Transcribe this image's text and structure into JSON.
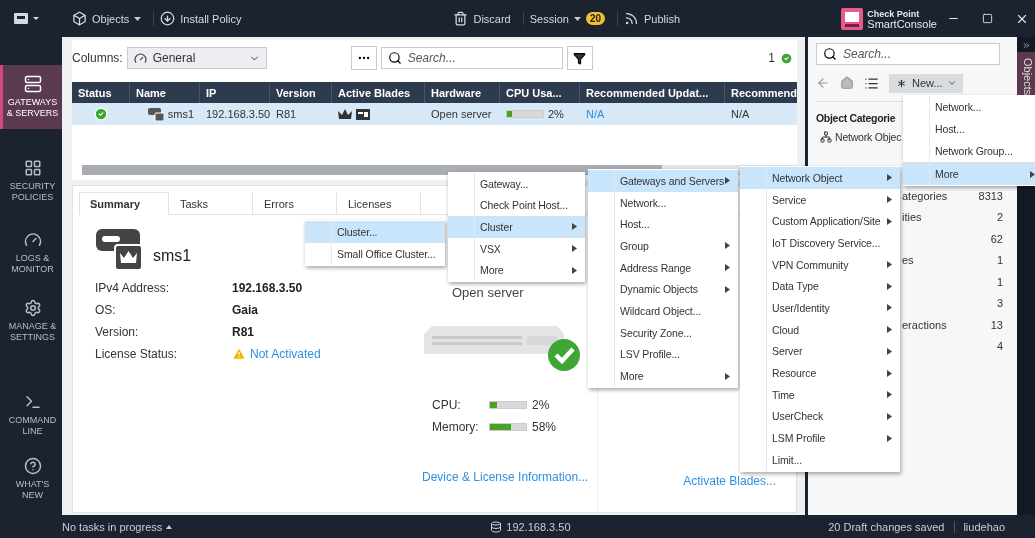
{
  "toolbar": {
    "left": [
      {
        "kind": "menu",
        "label": "Objects"
      },
      {
        "kind": "button",
        "label": "Install Policy"
      }
    ],
    "center": [
      {
        "kind": "button",
        "label": "Discard"
      },
      {
        "kind": "menu",
        "label": "Session",
        "badge": "20"
      },
      {
        "kind": "button",
        "label": "Publish"
      }
    ],
    "logo": {
      "brand": "Check Point",
      "product": "SmartConsole"
    }
  },
  "nav": [
    {
      "label": "GATEWAYS\n& SERVERS",
      "selected": true
    },
    {
      "label": "SECURITY\nPOLICIES",
      "selected": false
    },
    {
      "label": "LOGS &\nMONITOR",
      "selected": false
    },
    {
      "label": "MANAGE &\nSETTINGS",
      "selected": false
    },
    {
      "label": "COMMAND\nLINE",
      "selected": false
    },
    {
      "label": "WHAT'S\nNEW",
      "selected": false
    }
  ],
  "columns_bar": {
    "label": "Columns:",
    "value": "General",
    "search_placeholder": "Search...",
    "count": "1"
  },
  "table": {
    "columns": [
      "Status",
      "Name",
      "IP",
      "Version",
      "Active Blades",
      "Hardware",
      "CPU Usa...",
      "Recommended Updat...",
      "Recommend"
    ],
    "rows": [
      {
        "selected": true,
        "healthy": true,
        "name": "sms1",
        "ip": "192.168.3.50",
        "version": "R81",
        "hardware": "Open server",
        "cpu": {
          "level": 0.15,
          "reading": "2%"
        },
        "recommended_updates": "N/A",
        "recommend": "N/A"
      }
    ]
  },
  "details": {
    "tabs": [
      {
        "label": "Summary",
        "selected": true
      },
      {
        "label": "Tasks",
        "selected": false
      },
      {
        "label": "Errors",
        "selected": false
      },
      {
        "label": "Licenses",
        "selected": false
      }
    ],
    "name": "sms1",
    "fields": [
      {
        "label": "IPv4 Address:",
        "value": "192.168.3.50",
        "kind": "text"
      },
      {
        "label": "OS:",
        "value": "Gaia",
        "kind": "text"
      },
      {
        "label": "Version:",
        "value": "R81",
        "kind": "text"
      },
      {
        "label": "License Status:",
        "value": "Not Activated",
        "kind": "warning"
      }
    ],
    "hardware": "Open server",
    "metrics": [
      {
        "label": "CPU:",
        "level": 0.2,
        "reading": "2%"
      },
      {
        "label": "Memory:",
        "level": 0.58,
        "reading": "58%"
      }
    ],
    "links": [
      "Device & License Information...",
      "Activate Blades..."
    ]
  },
  "right_panel": {
    "search_placeholder": "Search...",
    "new_label": "New...",
    "heading": "Object Categorie",
    "first_item": "Network Objec",
    "rows": [
      {
        "label": "ategories",
        "count": "8313"
      },
      {
        "label": "ities",
        "count": "2"
      },
      {
        "count": "62"
      },
      {
        "label": "es",
        "count": "1"
      },
      {
        "count": "1"
      },
      {
        "count": "3"
      },
      {
        "label": "eractions",
        "count": "13"
      },
      {
        "count": "4"
      }
    ],
    "side_tab": "Objects"
  },
  "menus": [
    {
      "items": [
        {
          "label": "Cluster...",
          "submenu": false,
          "selected": true
        },
        {
          "label": "Small Office Cluster...",
          "submenu": false,
          "selected": false
        }
      ]
    },
    {
      "items": [
        {
          "label": "Gateway...",
          "submenu": false,
          "selected": false
        },
        {
          "label": "Check Point Host...",
          "submenu": false,
          "selected": false
        },
        {
          "label": "Cluster",
          "submenu": true,
          "selected": true
        },
        {
          "label": "VSX",
          "submenu": true,
          "selected": false
        },
        {
          "label": "More",
          "submenu": true,
          "selected": false
        }
      ]
    },
    {
      "items": [
        {
          "label": "Gateways and Servers",
          "submenu": true,
          "selected": true
        },
        {
          "label": "Network...",
          "submenu": false,
          "selected": false
        },
        {
          "label": "Host...",
          "submenu": false,
          "selected": false
        },
        {
          "label": "Group",
          "submenu": true,
          "selected": false
        },
        {
          "label": "Address Range",
          "submenu": true,
          "selected": false
        },
        {
          "label": "Dynamic Objects",
          "submenu": true,
          "selected": false
        },
        {
          "label": "Wildcard Object...",
          "submenu": false,
          "selected": false
        },
        {
          "label": "Security Zone...",
          "submenu": false,
          "selected": false
        },
        {
          "label": "LSV Profile...",
          "submenu": false,
          "selected": false
        },
        {
          "label": "More",
          "submenu": true,
          "selected": false
        }
      ]
    },
    {
      "items": [
        {
          "label": "Network Object",
          "submenu": true,
          "selected": true
        },
        {
          "label": "Service",
          "submenu": true,
          "selected": false
        },
        {
          "label": "Custom Application/Site",
          "submenu": true,
          "selected": false
        },
        {
          "label": "IoT Discovery Service...",
          "submenu": false,
          "selected": false
        },
        {
          "label": "VPN Community",
          "submenu": true,
          "selected": false
        },
        {
          "label": "Data Type",
          "submenu": true,
          "selected": false
        },
        {
          "label": "User/Identity",
          "submenu": true,
          "selected": false
        },
        {
          "label": "Cloud",
          "submenu": true,
          "selected": false
        },
        {
          "label": "Server",
          "submenu": true,
          "selected": false
        },
        {
          "label": "Resource",
          "submenu": true,
          "selected": false
        },
        {
          "label": "Time",
          "submenu": true,
          "selected": false
        },
        {
          "label": "UserCheck",
          "submenu": true,
          "selected": false
        },
        {
          "label": "LSM Profile",
          "submenu": true,
          "selected": false
        },
        {
          "label": "Limit...",
          "submenu": false,
          "selected": false
        }
      ]
    },
    {
      "items": [
        {
          "label": "Network...",
          "submenu": false,
          "selected": false
        },
        {
          "label": "Host...",
          "submenu": false,
          "selected": false
        },
        {
          "label": "Network Group...",
          "submenu": false,
          "selected": false
        },
        {
          "label": "More",
          "submenu": true,
          "selected": true,
          "separator_before": true
        }
      ]
    }
  ],
  "status_bar": {
    "tasks": "No tasks in progress",
    "server": "192.168.3.50",
    "drafts": "20 Draft changes saved",
    "user": "liudehao"
  }
}
